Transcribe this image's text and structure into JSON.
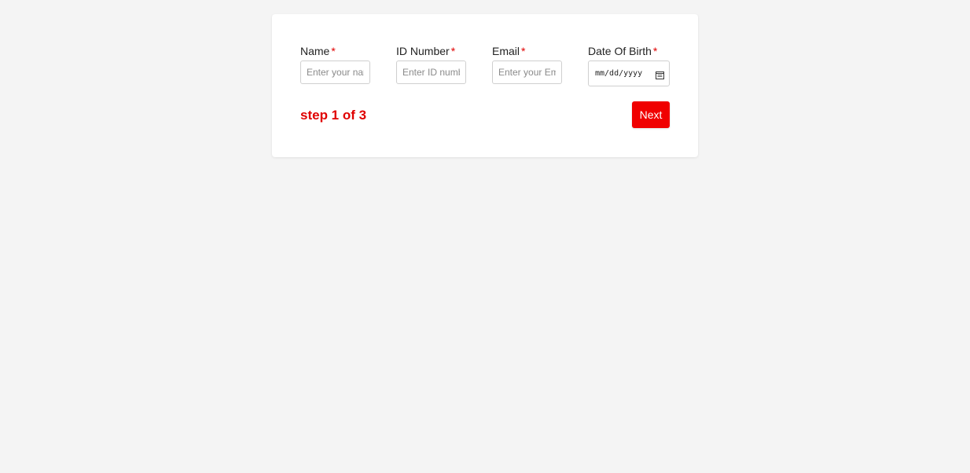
{
  "form": {
    "fields": [
      {
        "label": "Name",
        "required_mark": "*",
        "placeholder": "Enter your name",
        "value": ""
      },
      {
        "label": "ID Number",
        "required_mark": "*",
        "placeholder": "Enter ID number",
        "value": ""
      },
      {
        "label": "Email",
        "required_mark": "*",
        "placeholder": "Enter your Email",
        "value": ""
      },
      {
        "label": "Date Of Birth",
        "required_mark": "*",
        "date_format": "mm/dd/yyyy",
        "icon": "calendar-icon"
      }
    ],
    "step_text": "step 1 of 3",
    "next_label": "Next"
  },
  "colors": {
    "accent": "#f00000",
    "required": "#e00000",
    "background": "#f4f4f4",
    "card": "#ffffff"
  }
}
